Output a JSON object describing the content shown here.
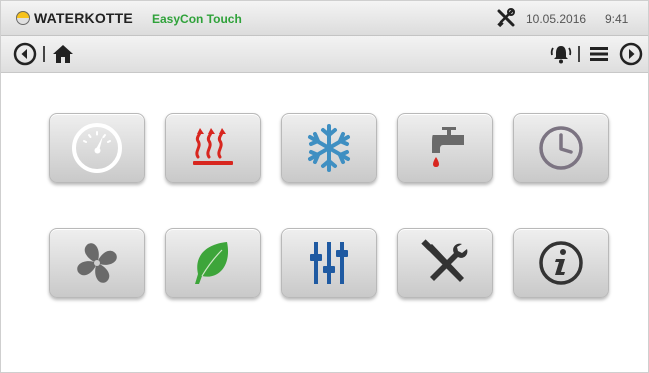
{
  "header": {
    "brand": "WATERKOTTE",
    "product": "EasyCon Touch",
    "date": "10.05.2016",
    "time": "9:41"
  },
  "nav": {
    "left": [
      "back-icon",
      "home-icon"
    ],
    "right": [
      "alarm-bell-icon",
      "menu-icon",
      "forward-icon"
    ]
  },
  "tiles": [
    [
      "gauge-icon",
      "heating-icon",
      "cooling-snowflake-icon",
      "hot-water-tap-icon",
      "clock-icon"
    ],
    [
      "fan-icon",
      "leaf-icon",
      "sliders-icon",
      "tools-icon",
      "info-icon"
    ]
  ],
  "colors": {
    "brand_yellow": "#f7c21a",
    "product_green": "#2fa23a",
    "heating_red": "#d8261f",
    "cooling_blue": "#3f8fc2",
    "leaf_green": "#3da53a",
    "slider_blue": "#1f5aa2"
  }
}
